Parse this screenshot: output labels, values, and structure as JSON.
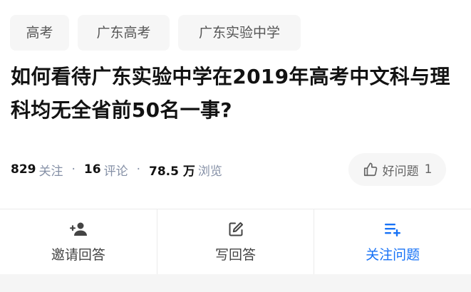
{
  "topics": [
    {
      "label": "高考"
    },
    {
      "label": "广东高考"
    },
    {
      "label": "广东实验中学"
    }
  ],
  "question": {
    "title": "如何看待广东实验中学在2019年高考中文科与理科均无全省前50名一事?"
  },
  "stats": {
    "followers": {
      "value": "829",
      "unit": "关注"
    },
    "comments": {
      "value": "16",
      "unit": "评论"
    },
    "views": {
      "value": "78.5 万",
      "unit": "浏览"
    },
    "separator": "·"
  },
  "good_question": {
    "label": "好问题",
    "count": "1"
  },
  "actions": {
    "invite": {
      "label": "邀请回答",
      "icon": "add-person-icon"
    },
    "write": {
      "label": "写回答",
      "icon": "edit-icon"
    },
    "follow": {
      "label": "关注问题",
      "icon": "playlist-add-icon"
    }
  },
  "colors": {
    "accent": "#1772f6",
    "tag_bg": "#f6f6f6",
    "muted": "#8590a6"
  }
}
